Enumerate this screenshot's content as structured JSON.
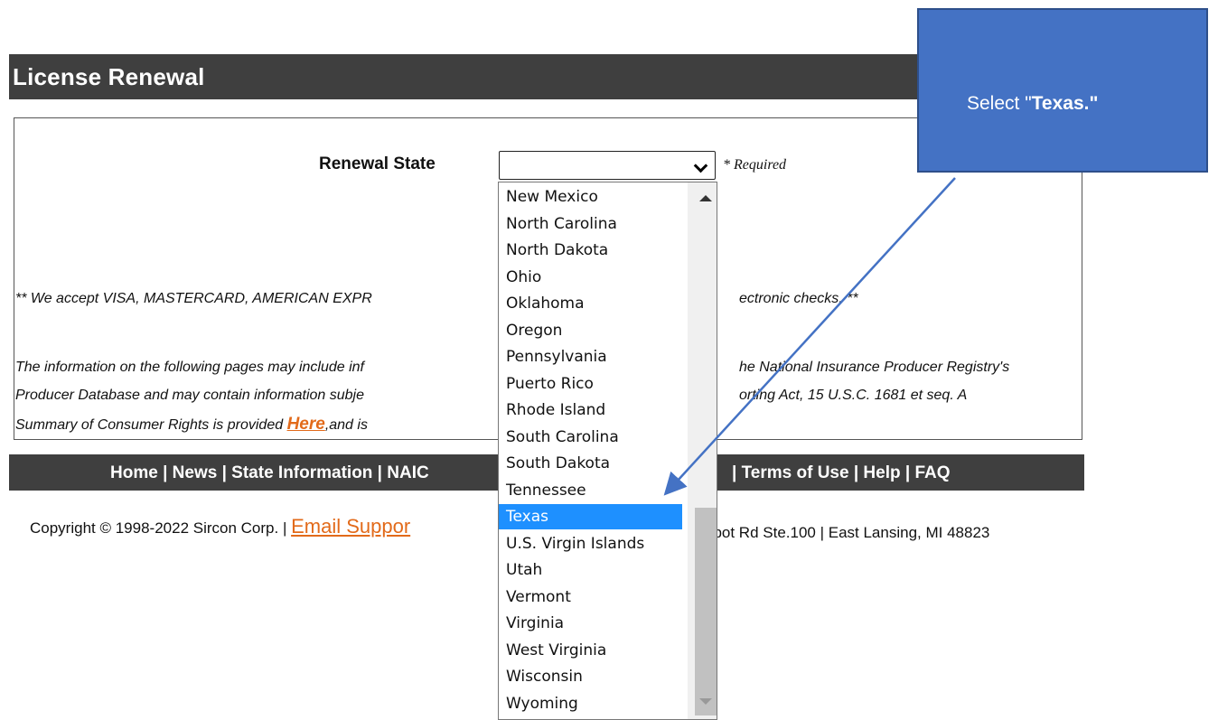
{
  "header": {
    "title": "License Renewal"
  },
  "form": {
    "state_label": "Renewal State",
    "required_text": "* Required"
  },
  "info": {
    "payment_line_left": "** We accept VISA, MASTERCARD, AMERICAN EXPR",
    "payment_line_right": "ectronic checks. **",
    "disclaimer_line1_left": "The information on the following pages may include inf",
    "disclaimer_line1_right": "he National Insurance Producer Registry's",
    "disclaimer_line2_left": "Producer Database and may contain information subje",
    "disclaimer_line2_right": "orting Act, 15 U.S.C. 1681 et seq. A",
    "disclaimer_line3_left": "Summary of Consumer Rights is provided ",
    "here_link": "Here",
    "disclaimer_line3_after": ",and is"
  },
  "footer_nav": {
    "left_text": "Home | News | State Information | NAIC",
    "right_text": "| Terms of Use | Help | FAQ"
  },
  "copyright": {
    "left_text": "Copyright © 1998-2022 Sircon Corp. | ",
    "email_link": "Email Suppor",
    "right_text": "bbot Rd Ste.100 | East Lansing, MI 48823"
  },
  "dropdown": {
    "selected": "Texas",
    "options": [
      "New Mexico",
      "North Carolina",
      "North Dakota",
      "Ohio",
      "Oklahoma",
      "Oregon",
      "Pennsylvania",
      "Puerto Rico",
      "Rhode Island",
      "South Carolina",
      "South Dakota",
      "Tennessee",
      "Texas",
      "U.S. Virgin Islands",
      "Utah",
      "Vermont",
      "Virginia",
      "West Virginia",
      "Wisconsin",
      "Wyoming"
    ]
  },
  "callout": {
    "prefix": "Select \"",
    "bold": "Texas.\""
  },
  "colors": {
    "callout_bg": "#4472c4",
    "selected_bg": "#1e90ff",
    "link": "#e26a1a",
    "bar_bg": "#3f3f3f"
  }
}
